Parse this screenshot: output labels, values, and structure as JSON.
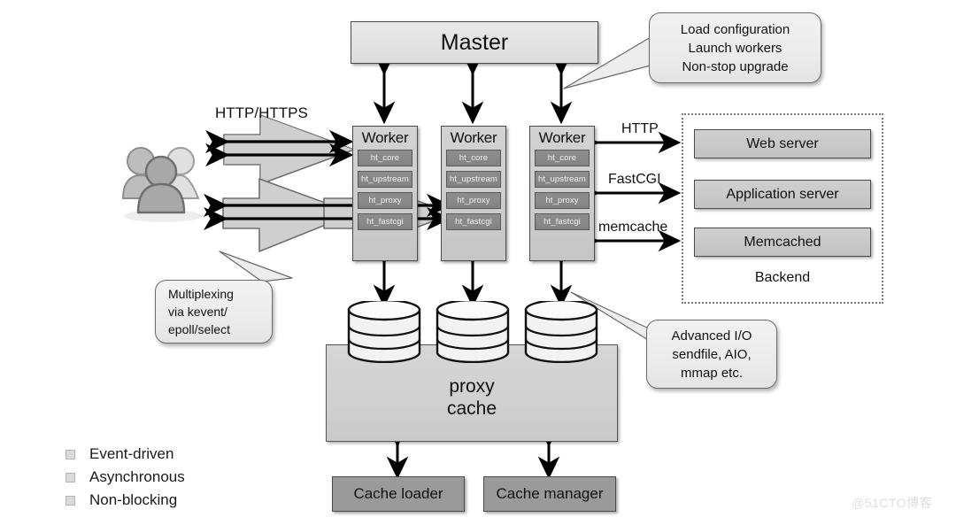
{
  "diagram": {
    "title": "nginx architecture diagram",
    "master": {
      "label": "Master"
    },
    "callouts": {
      "master": {
        "lines": [
          "Load configuration",
          "Launch workers",
          "Non-stop upgrade"
        ]
      },
      "multiplexing": {
        "lines": [
          "Multiplexing",
          "via kevent/",
          "epoll/select"
        ]
      },
      "advanced_io": {
        "lines": [
          "Advanced I/O",
          "sendfile, AIO,",
          "mmap etc."
        ]
      }
    },
    "workers": [
      {
        "title": "Worker",
        "modules": [
          "ht_core",
          "ht_upstream",
          "ht_proxy",
          "ht_fastcgi"
        ]
      },
      {
        "title": "Worker",
        "modules": [
          "ht_core",
          "ht_upstream",
          "ht_proxy",
          "ht_fastcgi"
        ]
      },
      {
        "title": "Worker",
        "modules": [
          "ht_core",
          "ht_upstream",
          "ht_proxy",
          "ht_fastcgi"
        ]
      }
    ],
    "client_link": {
      "label": "HTTP/HTTPS",
      "icon": "users-icon"
    },
    "backend": {
      "label": "Backend",
      "services": [
        {
          "label": "Web server",
          "protocol": "HTTP"
        },
        {
          "label": "Application server",
          "protocol": "FastCGI"
        },
        {
          "label": "Memcached",
          "protocol": "memcache"
        }
      ],
      "protocol_labels": [
        "HTTP",
        "FastCGI",
        "memcache"
      ]
    },
    "cache": {
      "store_label": "proxy\ncache",
      "store_label_line1": "proxy",
      "store_label_line2": "cache",
      "disk_count": 3,
      "workers_below": [
        {
          "label": "Cache loader"
        },
        {
          "label": "Cache manager"
        }
      ]
    },
    "features": [
      {
        "label": "Event-driven",
        "bullet": "square-bullet"
      },
      {
        "label": "Asynchronous",
        "bullet": "square-bullet"
      },
      {
        "label": "Non-blocking",
        "bullet": "square-bullet"
      }
    ],
    "watermark": {
      "text": "@51CTO博客"
    },
    "colors": {
      "background": "#ffffff",
      "box_light": "#e4e4e4",
      "box_mid": "#c6c6c6",
      "module_dark": "#888888",
      "cache_worker": "#9a9a9a",
      "stroke": "#4a4a4a",
      "callout_bg": "#ebebeb",
      "arrow": "#000000",
      "watermark": "#dedede"
    }
  }
}
